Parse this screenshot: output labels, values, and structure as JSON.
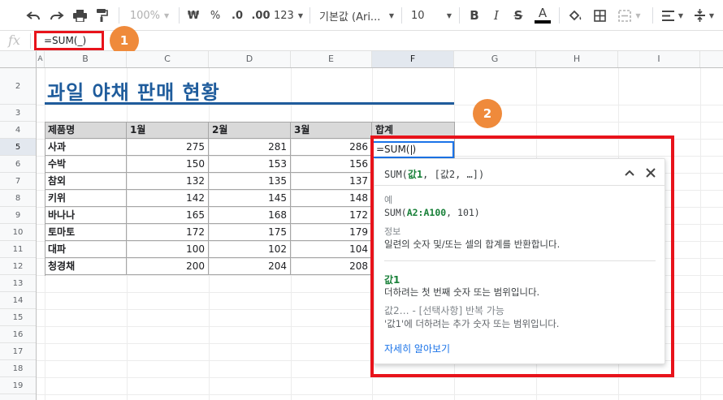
{
  "toolbar": {
    "zoom": "100%",
    "currency": "₩",
    "percent": "%",
    "decrease_decimal": ".0",
    "increase_decimal": ".00",
    "more_formats": "123",
    "font_name": "기본값 (Ari...",
    "font_size": "10"
  },
  "formula_bar": {
    "fx_label": "fx",
    "formula": "=SUM(_)"
  },
  "badges": [
    "1",
    "2"
  ],
  "columns": [
    "A",
    "B",
    "C",
    "D",
    "E",
    "F",
    "G",
    "H",
    "I"
  ],
  "rows": [
    "2",
    "3",
    "4",
    "5",
    "6",
    "7",
    "8",
    "9",
    "10",
    "11",
    "12",
    "13",
    "14",
    "15",
    "16",
    "17",
    "18",
    "19"
  ],
  "sheet": {
    "title": "과일 야채 판매 현황",
    "headers": [
      "제품명",
      "1월",
      "2월",
      "3월",
      "합계"
    ],
    "data_rows": [
      {
        "name": "사과",
        "m1": "275",
        "m2": "281",
        "m3": "286"
      },
      {
        "name": "수박",
        "m1": "150",
        "m2": "153",
        "m3": "156"
      },
      {
        "name": "참외",
        "m1": "132",
        "m2": "135",
        "m3": "137"
      },
      {
        "name": "키위",
        "m1": "142",
        "m2": "145",
        "m3": "148"
      },
      {
        "name": "바나나",
        "m1": "165",
        "m2": "168",
        "m3": "172"
      },
      {
        "name": "토마토",
        "m1": "172",
        "m2": "175",
        "m3": "179"
      },
      {
        "name": "대파",
        "m1": "100",
        "m2": "102",
        "m3": "104"
      },
      {
        "name": "청경채",
        "m1": "200",
        "m2": "204",
        "m3": "208"
      }
    ],
    "active_cell": {
      "before": "=SUM(",
      "after": ")"
    }
  },
  "help": {
    "sig_fn": "SUM(",
    "sig_arg1": "값1",
    "sig_rest": ", [값2, …])",
    "example_label": "예",
    "example_fn": "SUM(",
    "example_arg": "A2:A100",
    "example_rest": ", 101)",
    "info_label": "정보",
    "info_text": "일련의 숫자 및/또는 셀의 합계를 반환합니다.",
    "arg1_name": "값1",
    "arg1_desc": "더하려는 첫 번째 숫자 또는 범위입니다.",
    "arg2_name": "값2… - [선택사항] 반복 가능",
    "arg2_desc": "'값1'에 더하려는 추가 숫자 또는 범위입니다.",
    "learn_more": "자세히 알아보기"
  }
}
